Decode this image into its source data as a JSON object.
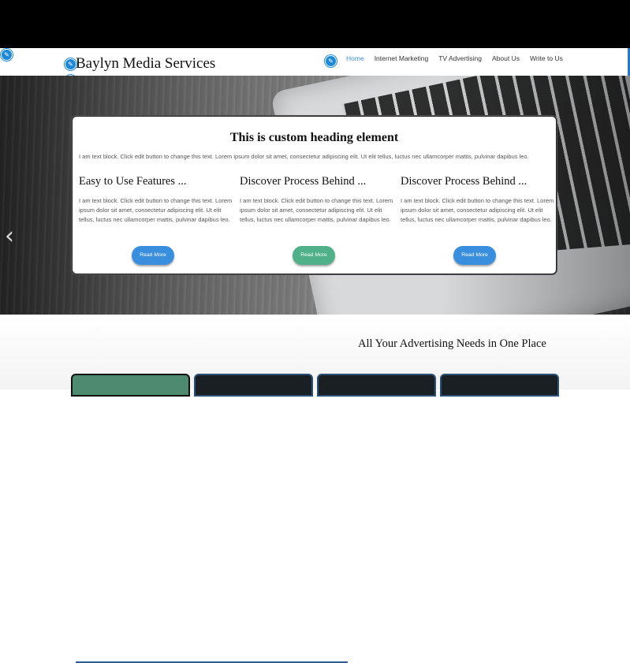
{
  "header": {
    "logo": "Baylyn Media Services",
    "nav": [
      {
        "label": "Home",
        "active": true
      },
      {
        "label": "Internet Marketing",
        "active": false
      },
      {
        "label": "TV Advertising",
        "active": false
      },
      {
        "label": "About Us",
        "active": false
      },
      {
        "label": "Write to Us",
        "active": false
      }
    ]
  },
  "hero": {
    "card": {
      "heading": "This is custom heading element",
      "intro": "I am text block. Click edit button to change this text. Lorem ipsum dolor sit amet, consectetur adipiscing elit. Ut elit tellus, luctus nec ullamcorper mattis, pulvinar dapibus leo.",
      "columns": [
        {
          "title": "Easy to Use Features ...",
          "text": "I am text block. Click edit button to change this text. Lorem ipsum dolor sit amet, consectetur adipiscing elit. Ut elit tellus, luctus nec ullamcorper mattis, pulvinar dapibus leo.",
          "button": "Read More",
          "button_color": "#3a8ede"
        },
        {
          "title": "Discover Process Behind ...",
          "text": "I am text block. Click edit button to change this text. Lorem ipsum dolor sit amet, consectetur adipiscing elit. Ut elit tellus, luctus nec ullamcorper mattis, pulvinar dapibus leo.",
          "button": "Read More",
          "button_color": "#4fb08a"
        },
        {
          "title": "Discover Process Behind ...",
          "text": "I am text block. Click edit button to change this text. Lorem ipsum dolor sit amet, consectetur adipiscing elit. Ut elit tellus, luctus nec ullamcorper mattis, pulvinar dapibus leo.",
          "button": "Read More",
          "button_color": "#3a8ede"
        }
      ]
    },
    "prev_arrow_icon": "chevron-left-icon",
    "prev_arrow_glyph": "‹"
  },
  "section": {
    "title": "All Your Advertising Needs in One Place"
  },
  "edit_icons": [
    "pencil-icon",
    "pencil-icon",
    "pencil-icon",
    "pencil-icon"
  ],
  "edit_glyph": "✎",
  "colors": {
    "accent": "#3b8fd9",
    "green": "#4fb08a",
    "rule": "#2f5f92"
  }
}
